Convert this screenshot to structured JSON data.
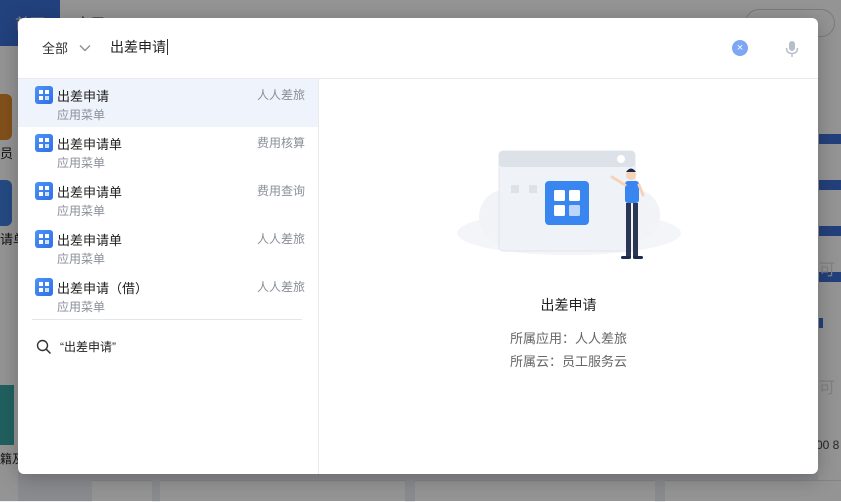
{
  "background": {
    "active_tab": "首页",
    "tab2": "应用",
    "left_text_1": "员",
    "left_text_2": "请单",
    "left_text_3": "籍及",
    "right_num": "00 8",
    "right_faint": "可"
  },
  "modal": {
    "scope": "全部",
    "query": "出差申请",
    "clear_symbol": "×",
    "results": [
      {
        "title": "出差申请",
        "sub": "应用菜单",
        "category": "人人差旅"
      },
      {
        "title": "出差申请单",
        "sub": "应用菜单",
        "category": "费用核算"
      },
      {
        "title": "出差申请单",
        "sub": "应用菜单",
        "category": "费用查询"
      },
      {
        "title": "出差申请单",
        "sub": "应用菜单",
        "category": "人人差旅"
      },
      {
        "title": "出差申请（借）",
        "sub": "应用菜单",
        "category": "人人差旅"
      }
    ],
    "search_all": "“出差申请”",
    "detail": {
      "title": "出差申请",
      "app_line": "所属应用：人人差旅",
      "cloud_line": "所属云：员工服务云"
    }
  },
  "colors": {
    "accent": "#3b73d9",
    "selected_row": "#eef3fc",
    "clear_button": "#7da6f5"
  }
}
